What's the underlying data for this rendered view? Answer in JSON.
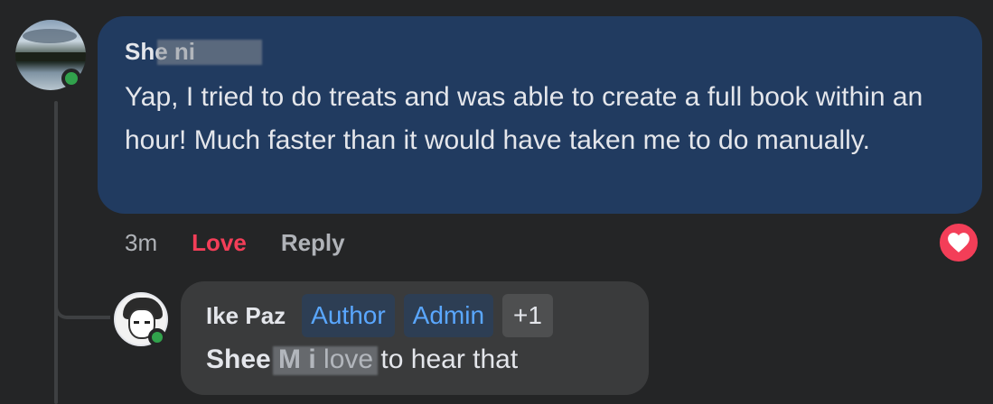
{
  "comment": {
    "author": "Sheeri Mai",
    "author_display": "She      ni",
    "text": "Yap, I tried to do treats and was able to create a full book within an hour! Much faster than it would have taken me to do manually.",
    "time": "3m",
    "love_label": "Love",
    "reply_label": "Reply",
    "reaction_icon": "heart-icon",
    "colors": {
      "bubble": "#213b60",
      "love": "#f33e58",
      "online": "#31a24c"
    }
  },
  "reply": {
    "author": "Ike Paz",
    "badges": [
      "Author",
      "Admin"
    ],
    "badge_extra": "+1",
    "mention": "Shee      M i",
    "text": " love to hear that",
    "colors": {
      "bubble": "#3a3b3c",
      "badge_text": "#5aa7ff"
    }
  }
}
